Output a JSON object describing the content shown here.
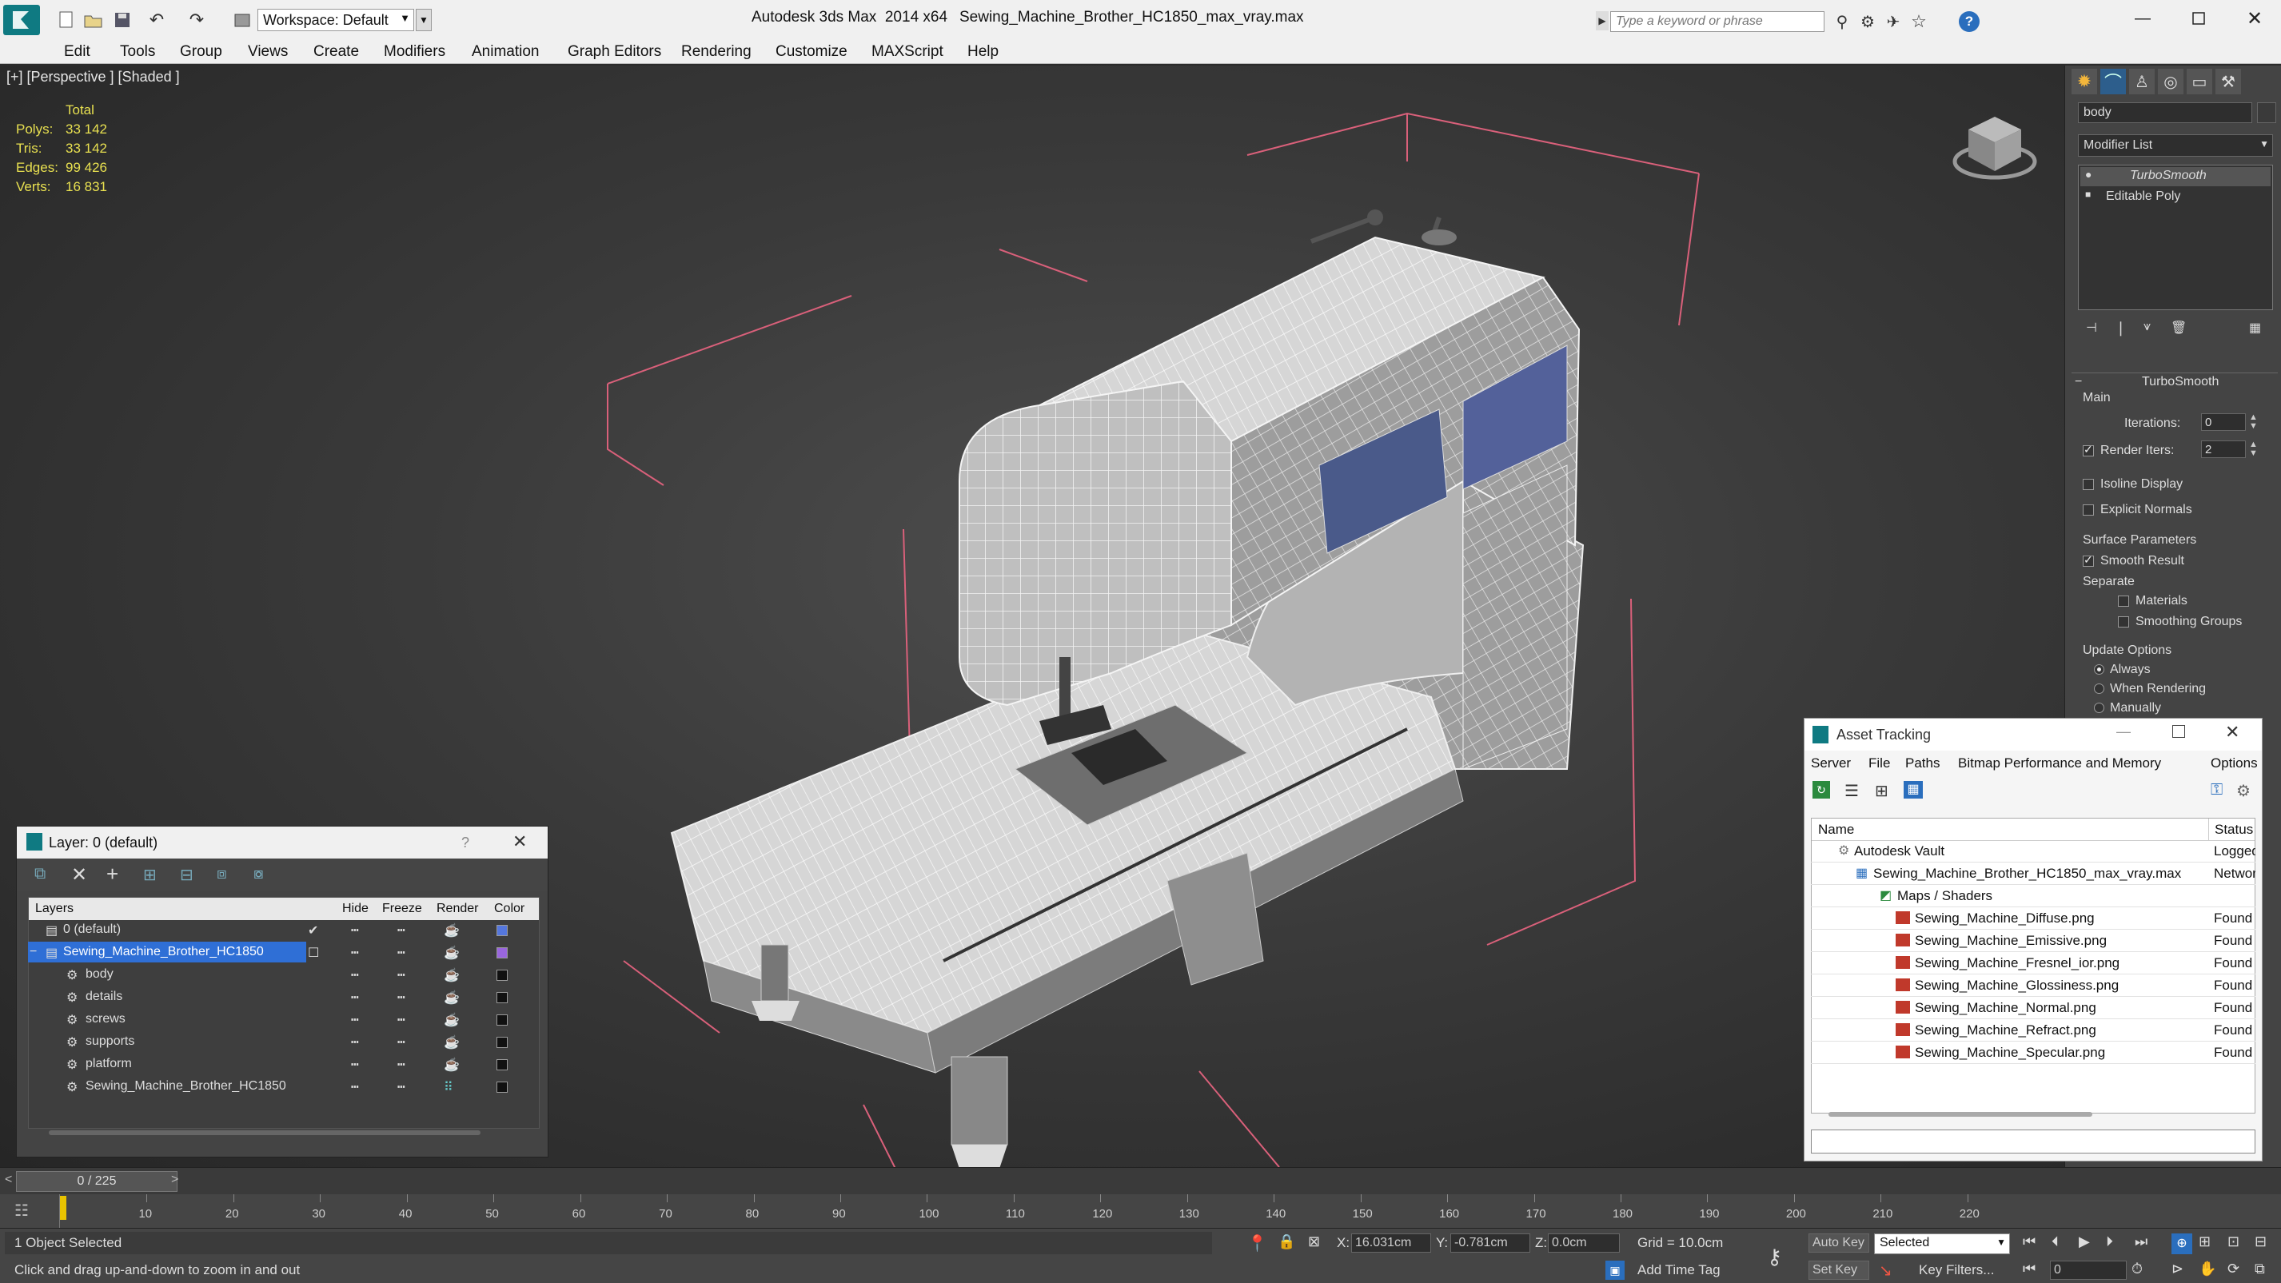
{
  "title_bar": {
    "workspace_label": "Workspace: Default",
    "app_title": "Autodesk 3ds Max  2014 x64",
    "file_title": "Sewing_Machine_Brother_HC1850_max_vray.max",
    "search_placeholder": "Type a keyword or phrase"
  },
  "menu": [
    "Edit",
    "Tools",
    "Group",
    "Views",
    "Create",
    "Modifiers",
    "Animation",
    "Graph Editors",
    "Rendering",
    "Customize",
    "MAXScript",
    "Help"
  ],
  "viewport": {
    "label": "[+] [Perspective ] [Shaded ]",
    "stats": {
      "total_label": "Total",
      "rows": [
        {
          "label": "Polys:",
          "value": "33 142"
        },
        {
          "label": "Tris:",
          "value": "33 142"
        },
        {
          "label": "Edges:",
          "value": "99 426"
        },
        {
          "label": "Verts:",
          "value": "16 831"
        }
      ]
    }
  },
  "command_panel": {
    "object_name": "body",
    "modifier_list_label": "Modifier List",
    "stack": [
      "TurboSmooth",
      "Editable Poly"
    ],
    "rollout_title": "TurboSmooth",
    "main_label": "Main",
    "iterations_label": "Iterations:",
    "iterations_value": "0",
    "render_iters_label": "Render Iters:",
    "render_iters_value": "2",
    "isoline_label": "Isoline Display",
    "explicit_normals_label": "Explicit Normals",
    "surface_params_label": "Surface Parameters",
    "smooth_result_label": "Smooth Result",
    "separate_label": "Separate",
    "materials_label": "Materials",
    "smoothing_groups_label": "Smoothing Groups",
    "update_options_label": "Update Options",
    "always_label": "Always",
    "when_rendering_label": "When Rendering",
    "manually_label": "Manually"
  },
  "layer_window": {
    "title": "Layer: 0 (default)",
    "help": "?",
    "columns": {
      "layers": "Layers",
      "hide": "Hide",
      "freeze": "Freeze",
      "render": "Render",
      "color": "Color"
    },
    "rows": [
      {
        "name": "0 (default)",
        "color": "#5577dd"
      },
      {
        "name": "Sewing_Machine_Brother_HC1850",
        "color": "#9966dd"
      },
      {
        "name": "body",
        "color": "#111111"
      },
      {
        "name": "details",
        "color": "#111111"
      },
      {
        "name": "screws",
        "color": "#111111"
      },
      {
        "name": "supports",
        "color": "#111111"
      },
      {
        "name": "platform",
        "color": "#111111"
      },
      {
        "name": "Sewing_Machine_Brother_HC1850",
        "color": "#111111"
      }
    ]
  },
  "asset_tracking": {
    "title": "Asset Tracking",
    "menu": [
      "Server",
      "File",
      "Paths",
      "Bitmap Performance and Memory",
      "Options"
    ],
    "columns": {
      "name": "Name",
      "status": "Status"
    },
    "rows": [
      {
        "name": "Autodesk Vault",
        "status": "Logged"
      },
      {
        "name": "Sewing_Machine_Brother_HC1850_max_vray.max",
        "status": "Networ"
      },
      {
        "name": "Maps / Shaders",
        "status": ""
      },
      {
        "name": "Sewing_Machine_Diffuse.png",
        "status": "Found"
      },
      {
        "name": "Sewing_Machine_Emissive.png",
        "status": "Found"
      },
      {
        "name": "Sewing_Machine_Fresnel_ior.png",
        "status": "Found"
      },
      {
        "name": "Sewing_Machine_Glossiness.png",
        "status": "Found"
      },
      {
        "name": "Sewing_Machine_Normal.png",
        "status": "Found"
      },
      {
        "name": "Sewing_Machine_Refract.png",
        "status": "Found"
      },
      {
        "name": "Sewing_Machine_Specular.png",
        "status": "Found"
      }
    ]
  },
  "timeline": {
    "frame_label": "0 / 225",
    "ticks": [
      "10",
      "20",
      "30",
      "40",
      "50",
      "60",
      "70",
      "80",
      "90",
      "100",
      "110",
      "120",
      "130",
      "140",
      "150",
      "160",
      "170",
      "180",
      "190",
      "200",
      "210",
      "220"
    ]
  },
  "status_bar": {
    "selection": "1 Object Selected",
    "hint": "Click and drag up-and-down to zoom in and out",
    "x_label": "X:",
    "x_value": "16.031cm",
    "y_label": "Y:",
    "y_value": "-0.781cm",
    "z_label": "Z:",
    "z_value": "0.0cm",
    "grid": "Grid = 10.0cm",
    "add_time_tag": "Add Time Tag",
    "auto_key": "Auto Key",
    "set_key": "Set Key",
    "selected_option": "Selected",
    "key_filters": "Key Filters...",
    "frame_value": "0"
  }
}
